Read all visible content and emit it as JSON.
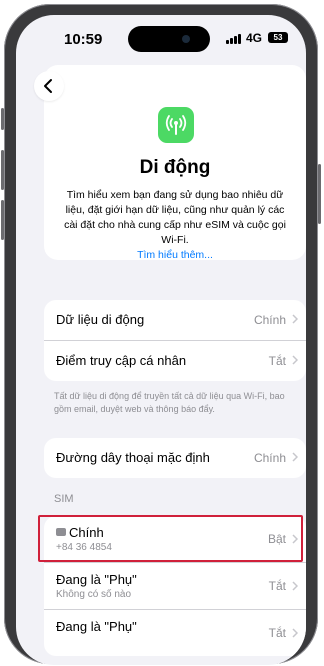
{
  "status_bar": {
    "time": "10:59",
    "network": "4G",
    "battery": "53"
  },
  "header": {
    "back_icon": "chevron-left-icon",
    "app_icon": "antenna-radiowaves-icon",
    "title": "Di động",
    "description": "Tìm hiểu xem bạn đang sử dụng bao nhiêu dữ liệu, đặt giới hạn dữ liệu, cũng như quản lý các cài đặt cho nhà cung cấp như eSIM và cuộc gọi Wi-Fi.",
    "learn_more": "Tìm hiểu thêm..."
  },
  "settings_group": {
    "items": [
      {
        "label": "Dữ liệu di động",
        "value": "Chính"
      },
      {
        "label": "Điểm truy cập cá nhân",
        "value": "Tắt"
      }
    ],
    "footnote": "Tất dữ liệu di động để truyền tất cả dữ liệu qua Wi-Fi, bao gồm email, duyệt web và thông báo đẩy."
  },
  "default_line": {
    "label": "Đường dây thoại mặc định",
    "value": "Chính"
  },
  "sim": {
    "header": "SIM",
    "items": [
      {
        "title": "Chính",
        "subtitle": "+84 36 4854",
        "value": "Bật"
      },
      {
        "title": "Đang là \"Phụ\"",
        "subtitle": "Không có số nào",
        "value": "Tắt"
      },
      {
        "title": "Đang là \"Phụ\"",
        "subtitle": "",
        "value": "Tắt"
      }
    ]
  },
  "colors": {
    "accent": "#007aff",
    "app_icon_bg": "#4cd964",
    "highlight": "#d0203a",
    "background": "#f2f2f7"
  }
}
